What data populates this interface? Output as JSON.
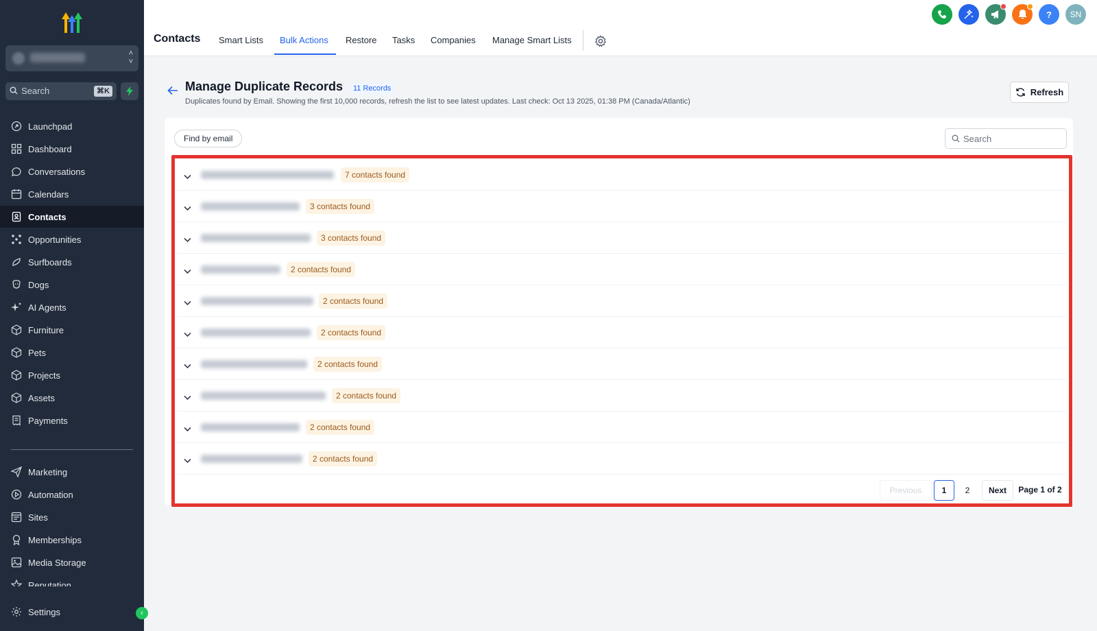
{
  "app": {
    "title": "Contacts"
  },
  "sidebar": {
    "search_placeholder": "Search",
    "search_shortcut": "⌘K",
    "items": [
      {
        "label": "Launchpad",
        "icon": "launchpad-icon"
      },
      {
        "label": "Dashboard",
        "icon": "dashboard-icon"
      },
      {
        "label": "Conversations",
        "icon": "chat-icon"
      },
      {
        "label": "Calendars",
        "icon": "calendar-icon"
      },
      {
        "label": "Contacts",
        "icon": "contacts-icon",
        "active": true
      },
      {
        "label": "Opportunities",
        "icon": "opportunities-icon"
      },
      {
        "label": "Surfboards",
        "icon": "surfboard-icon"
      },
      {
        "label": "Dogs",
        "icon": "dog-icon"
      },
      {
        "label": "AI Agents",
        "icon": "sparkle-icon"
      },
      {
        "label": "Furniture",
        "icon": "box-icon"
      },
      {
        "label": "Pets",
        "icon": "box-icon"
      },
      {
        "label": "Projects",
        "icon": "box-icon"
      },
      {
        "label": "Assets",
        "icon": "box-icon"
      },
      {
        "label": "Payments",
        "icon": "receipt-icon"
      },
      {
        "label": "Marketing",
        "icon": "send-icon"
      },
      {
        "label": "Automation",
        "icon": "automation-icon"
      },
      {
        "label": "Sites",
        "icon": "sites-icon"
      },
      {
        "label": "Memberships",
        "icon": "award-icon"
      },
      {
        "label": "Media Storage",
        "icon": "image-icon"
      },
      {
        "label": "Reputation",
        "icon": "star-icon"
      }
    ],
    "settings_label": "Settings"
  },
  "topnav": {
    "title": "Contacts",
    "tabs": [
      {
        "label": "Smart Lists"
      },
      {
        "label": "Bulk Actions",
        "active": true
      },
      {
        "label": "Restore"
      },
      {
        "label": "Tasks"
      },
      {
        "label": "Companies"
      },
      {
        "label": "Manage Smart Lists"
      }
    ],
    "actions": [
      {
        "icon": "phone-icon",
        "color": "#16a34a"
      },
      {
        "icon": "magic-icon",
        "color": "#2563eb"
      },
      {
        "icon": "megaphone-icon",
        "color": "#3b8c6e"
      },
      {
        "icon": "bell-icon",
        "color": "#f97316"
      },
      {
        "icon": "help-icon",
        "color": "#3b82f6"
      }
    ],
    "avatar_initials": "SN"
  },
  "main": {
    "title": "Manage Duplicate Records",
    "records_badge": "11 Records",
    "subtitle": "Duplicates found by Email. Showing the first 10,000 records, refresh the list to see latest updates. Last check: Oct 13 2025, 01:38 PM (Canada/Atlantic)",
    "refresh_label": "Refresh",
    "filter_label": "Find by email",
    "search_placeholder": "Search",
    "rows": [
      {
        "count_label": "7 contacts found"
      },
      {
        "count_label": "3 contacts found"
      },
      {
        "count_label": "3 contacts found"
      },
      {
        "count_label": "2 contacts found"
      },
      {
        "count_label": "2 contacts found"
      },
      {
        "count_label": "2 contacts found"
      },
      {
        "count_label": "2 contacts found"
      },
      {
        "count_label": "2 contacts found"
      },
      {
        "count_label": "2 contacts found"
      },
      {
        "count_label": "2 contacts found"
      }
    ],
    "pagination": {
      "previous": "Previous",
      "pages": [
        "1",
        "2"
      ],
      "current": "1",
      "next": "Next",
      "info": "Page 1 of 2"
    }
  },
  "colors": {
    "sidebar_bg": "#212b3b",
    "accent": "#2563eb",
    "highlight": "#e3342f",
    "badge_text": "#9a5a1b",
    "badge_bg": "#fdf3e3"
  }
}
